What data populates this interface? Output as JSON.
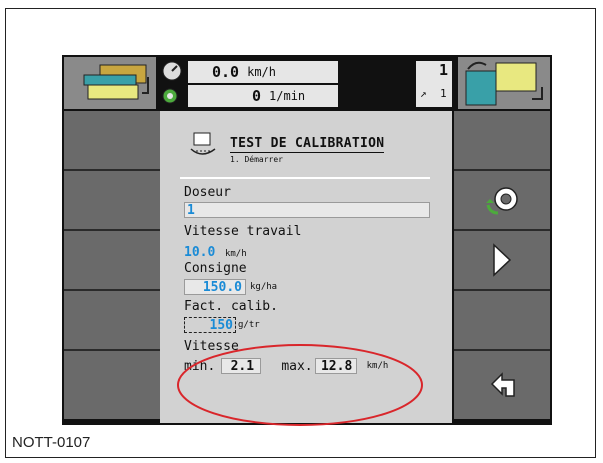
{
  "topbar": {
    "speed_value": "0.0",
    "speed_unit": "km/h",
    "rpm_value": "0",
    "rpm_unit": "1/min",
    "counter_value": "1",
    "counter_sub": "1"
  },
  "panel": {
    "title": "TEST DE CALIBRATION",
    "subtitle": "1. Démarrer",
    "doseur_label": "Doseur",
    "doseur_value": "1",
    "vitesse_travail_label": "Vitesse travail",
    "vitesse_travail_value": "10.0",
    "vitesse_travail_unit": "km/h",
    "consigne_label": "Consigne",
    "consigne_value": "150.0",
    "consigne_unit": "kg/ha",
    "fact_label": "Fact. calib.",
    "fact_value": "150",
    "fact_unit": "g/tr",
    "vitesse_label": "Vitesse",
    "min_label": "min.",
    "min_value": "2.1",
    "max_label": "max.",
    "max_value": "12.8",
    "max_unit": "km/h"
  },
  "caption": "NOTT-0107",
  "colors": {
    "accent_blue": "#1a8bd6",
    "highlight_ellipse": "#d9262b"
  }
}
